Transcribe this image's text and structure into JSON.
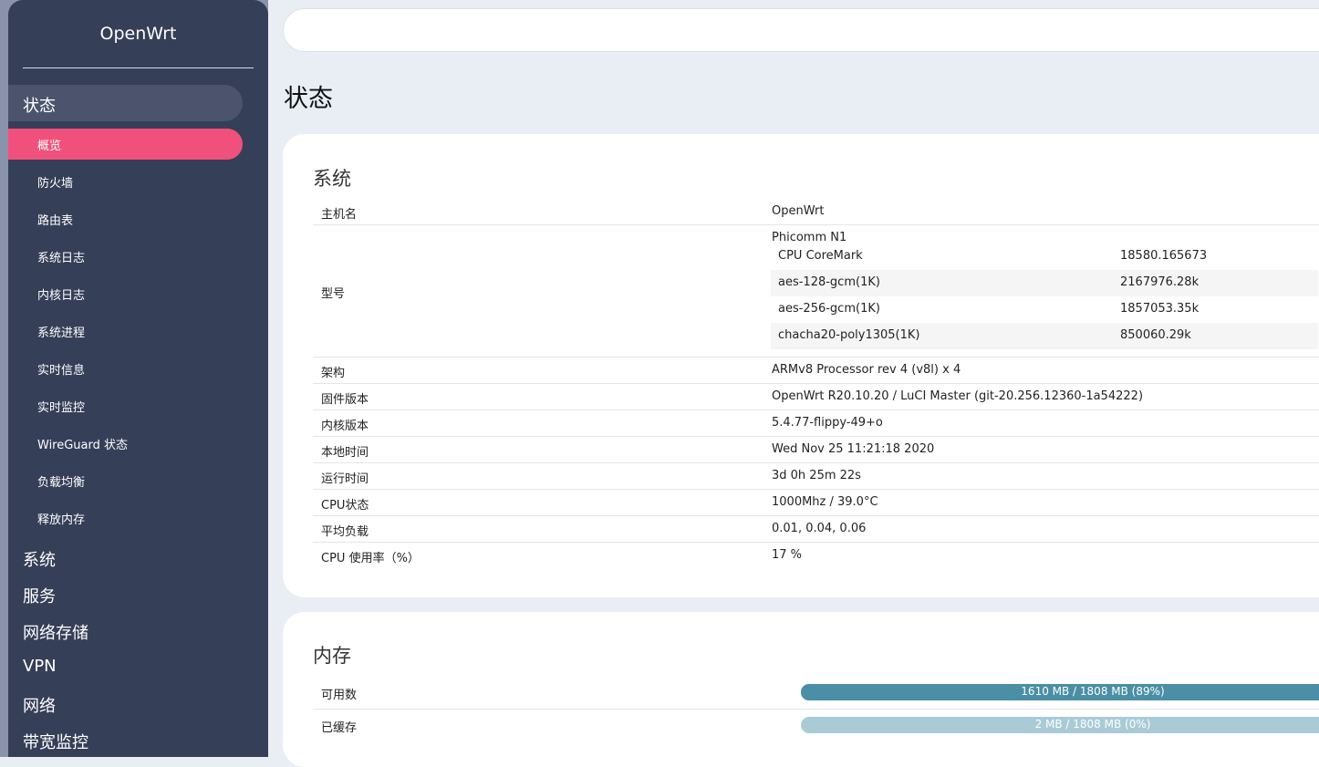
{
  "sidebar": {
    "brand": "OpenWrt",
    "active_category": "状态",
    "status_items": [
      "概览",
      "防火墙",
      "路由表",
      "系统日志",
      "内核日志",
      "系统进程",
      "实时信息",
      "实时监控",
      "WireGuard 状态",
      "负载均衡",
      "释放内存"
    ],
    "categories": [
      "系统",
      "服务",
      "网络存储",
      "VPN",
      "网络",
      "带宽监控"
    ]
  },
  "page": {
    "title": "状态"
  },
  "system": {
    "title": "系统",
    "hostname": {
      "label": "主机名",
      "value": "OpenWrt"
    },
    "model": {
      "label": "型号",
      "value": "Phicomm N1",
      "benchmarks": [
        {
          "name": "CPU CoreMark",
          "value": "18580.165673"
        },
        {
          "name": "aes-128-gcm(1K)",
          "value": "2167976.28k"
        },
        {
          "name": "aes-256-gcm(1K)",
          "value": "1857053.35k"
        },
        {
          "name": "chacha20-poly1305(1K)",
          "value": "850060.29k"
        }
      ]
    },
    "rows": [
      {
        "label": "架构",
        "value": "ARMv8 Processor rev 4 (v8l) x 4"
      },
      {
        "label": "固件版本",
        "value": "OpenWrt R20.10.20 / LuCI Master (git-20.256.12360-1a54222)"
      },
      {
        "label": "内核版本",
        "value": "5.4.77-flippy-49+o"
      },
      {
        "label": "本地时间",
        "value": "Wed Nov 25 11:21:18 2020"
      },
      {
        "label": "运行时间",
        "value": "3d 0h 25m 22s"
      },
      {
        "label": "CPU状态",
        "value": "1000Mhz / 39.0°C"
      },
      {
        "label": "平均负载",
        "value": "0.01, 0.04, 0.06"
      },
      {
        "label": "CPU 使用率（%）",
        "value": "17 %"
      }
    ]
  },
  "memory": {
    "title": "内存",
    "rows": [
      {
        "label": "可用数",
        "value": "1610 MB / 1808 MB (89%)",
        "fraction": 0.89,
        "color": "#4a8fa5"
      },
      {
        "label": "已缓存",
        "value": "2 MB / 1808 MB (0%)",
        "fraction": 0.0,
        "color": "#a9cbd6"
      }
    ]
  },
  "colors": {
    "sidebar": "#363f58",
    "accent": "#f0517c",
    "active_category": "#4b546c"
  }
}
